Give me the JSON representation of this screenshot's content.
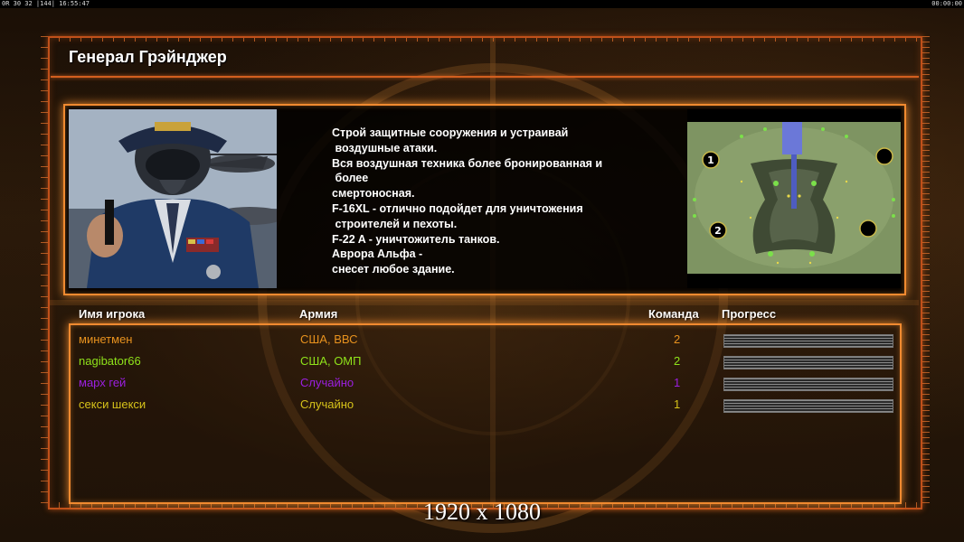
{
  "topbar": {
    "left": "0R 30 32 |144| 16:55:47",
    "right": "00:00:00"
  },
  "general": {
    "title": "Генерал Грэйнджер"
  },
  "description": {
    "lines": [
      "Строй защитные сооружения и устраивай",
      " воздушные атаки.",
      "Вся воздушная техника более бронированная и",
      " более",
      "смертоносная.",
      "F-16XL - отлично подойдет для уничтожения",
      " строителей и пехоты.",
      "F-22 A - уничтожитель танков.",
      "Аврора Альфа -",
      "снесет любое здание."
    ]
  },
  "minimap": {
    "start_positions": [
      "1",
      "2"
    ]
  },
  "table": {
    "headers": {
      "player": "Имя игрока",
      "army": "Армия",
      "team": "Команда",
      "progress": "Прогресс"
    },
    "rows": [
      {
        "name": "минетмен",
        "army": "США, ВВС",
        "team": "2",
        "progress": 1.0,
        "color": "#e8921e"
      },
      {
        "name": "nagibator66",
        "army": "США, ОМП",
        "team": "2",
        "progress": 1.0,
        "color": "#8fe21a"
      },
      {
        "name": "марх гей",
        "army": "Случайно",
        "team": "1",
        "progress": 1.0,
        "color": "#9b1fe0"
      },
      {
        "name": "секси шекси",
        "army": "Случайно",
        "team": "1",
        "progress": 1.0,
        "color": "#d6c21a"
      }
    ]
  },
  "resolution_label": "1920 x 1080",
  "colors": {
    "frame": "#c0501a",
    "panel_border": "#f08a30"
  }
}
